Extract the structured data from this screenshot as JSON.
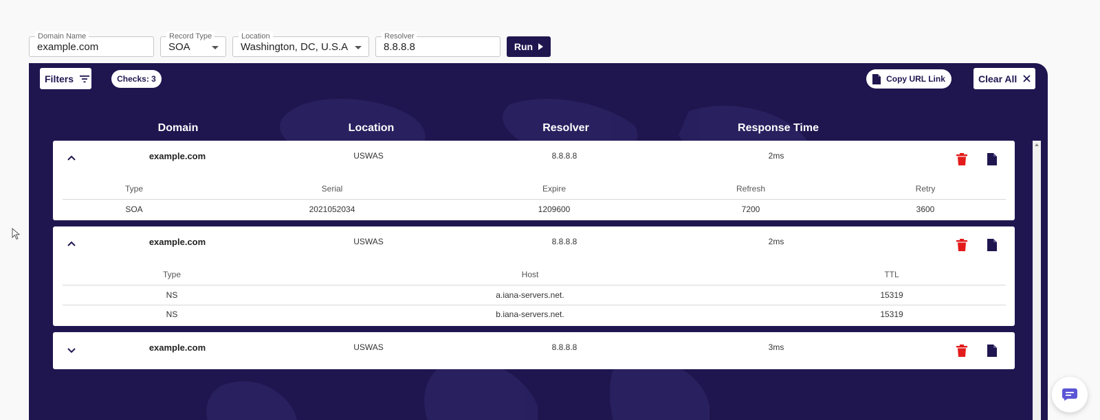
{
  "form": {
    "domain": {
      "label": "Domain Name",
      "value": "example.com"
    },
    "record_type": {
      "label": "Record Type",
      "value": "SOA"
    },
    "location": {
      "label": "Location",
      "value": "Washington, DC, U.S.A"
    },
    "resolver": {
      "label": "Resolver",
      "value": "8.8.8.8"
    },
    "run_label": "Run"
  },
  "toolbar": {
    "filters_label": "Filters",
    "checks_label": "Checks: 3",
    "copy_url_label": "Copy URL Link",
    "clear_all_label": "Clear All"
  },
  "columns": [
    "Domain",
    "Location",
    "Resolver",
    "Response Time"
  ],
  "results": [
    {
      "domain": "example.com",
      "location": "USWAS",
      "resolver": "8.8.8.8",
      "response_time": "2ms",
      "expanded": true,
      "detail_headers": [
        "Type",
        "Serial",
        "Expire",
        "Refresh",
        "Retry"
      ],
      "detail_rows": [
        [
          "SOA",
          "2021052034",
          "1209600",
          "7200",
          "3600"
        ]
      ]
    },
    {
      "domain": "example.com",
      "location": "USWAS",
      "resolver": "8.8.8.8",
      "response_time": "2ms",
      "expanded": true,
      "detail_headers": [
        "Type",
        "Host",
        "TTL"
      ],
      "detail_rows": [
        [
          "NS",
          "a.iana-servers.net.",
          "15319"
        ],
        [
          "NS",
          "b.iana-servers.net.",
          "15319"
        ]
      ]
    },
    {
      "domain": "example.com",
      "location": "USWAS",
      "resolver": "8.8.8.8",
      "response_time": "3ms",
      "expanded": false,
      "detail_headers": [],
      "detail_rows": []
    }
  ],
  "colors": {
    "panel": "#1f1650",
    "delete_icon": "#e31b1b",
    "accent": "#5b55d6"
  },
  "icons": {
    "filters": "filter-lines-icon",
    "run": "play-icon",
    "copy": "document-icon",
    "clear": "close-icon",
    "collapse": "chevron-up-icon",
    "expand": "chevron-down-icon",
    "delete": "trash-icon",
    "export": "document-icon",
    "chat": "chat-bubble-icon"
  }
}
